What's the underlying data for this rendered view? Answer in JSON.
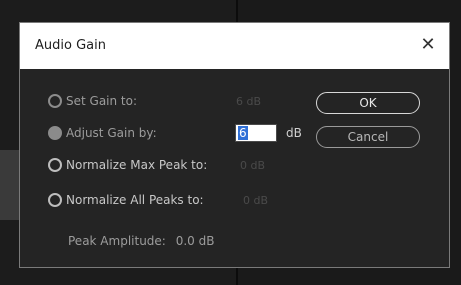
{
  "dialog": {
    "title": "Audio Gain",
    "close_glyph": "✕",
    "options": [
      {
        "label": "Set Gain to:",
        "value": "6 dB",
        "selected": false
      },
      {
        "label": "Adjust Gain by:",
        "value": "6",
        "unit": "dB",
        "selected": true
      },
      {
        "label": "Normalize Max Peak to:",
        "value": "0 dB",
        "selected": false
      },
      {
        "label": "Normalize All Peaks to:",
        "value": "0 dB",
        "selected": false
      }
    ],
    "ok_label": "OK",
    "cancel_label": "Cancel",
    "peak_label": "Peak Amplitude:",
    "peak_value": "0.0 dB"
  },
  "colors": {
    "dialog_bg": "#242424",
    "titlebar_bg": "#ffffff",
    "selection_blue": "#2f6fd6"
  }
}
